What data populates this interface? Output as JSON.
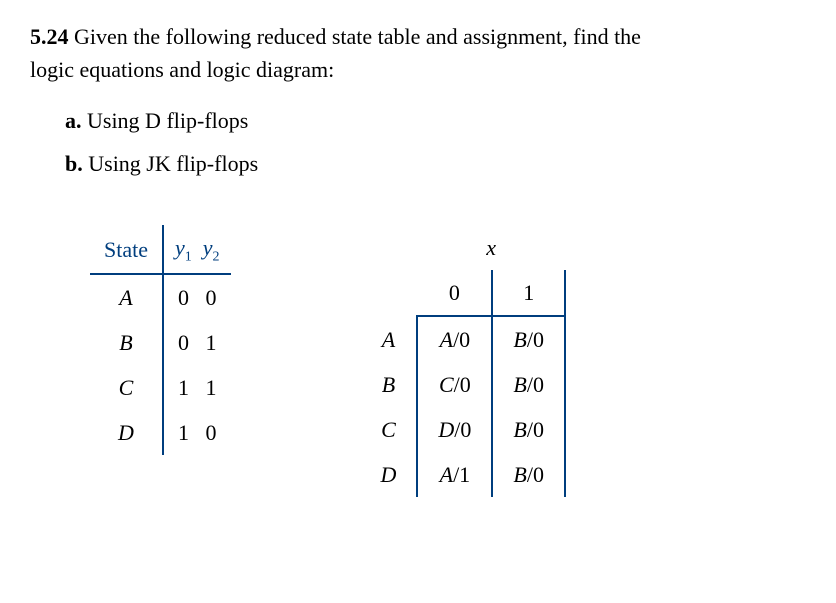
{
  "problem": {
    "number": "5.24",
    "text_line1": "Given the following reduced state table and assignment, find the",
    "text_line2": "logic equations and logic diagram:"
  },
  "parts": {
    "a": {
      "letter": "a.",
      "text": "Using D flip-flops"
    },
    "b": {
      "letter": "b.",
      "text": "Using JK flip-flops"
    }
  },
  "assignment_table": {
    "header": {
      "state": "State",
      "y1": "y",
      "y1sub": "1",
      "y2": "y",
      "y2sub": "2"
    },
    "rows": [
      {
        "state": "A",
        "y1": "0",
        "y2": "0"
      },
      {
        "state": "B",
        "y1": "0",
        "y2": "1"
      },
      {
        "state": "C",
        "y1": "1",
        "y2": "1"
      },
      {
        "state": "D",
        "y1": "1",
        "y2": "0"
      }
    ]
  },
  "transition_table": {
    "x_label": "x",
    "col_headers": {
      "c0": "0",
      "c1": "1"
    },
    "rows": [
      {
        "state": "A",
        "c0state": "A",
        "c0out": "/0",
        "c1state": "B",
        "c1out": "/0"
      },
      {
        "state": "B",
        "c0state": "C",
        "c0out": "/0",
        "c1state": "B",
        "c1out": "/0"
      },
      {
        "state": "C",
        "c0state": "D",
        "c0out": "/0",
        "c1state": "B",
        "c1out": "/0"
      },
      {
        "state": "D",
        "c0state": "A",
        "c0out": "/1",
        "c1state": "B",
        "c1out": "/0"
      }
    ]
  }
}
